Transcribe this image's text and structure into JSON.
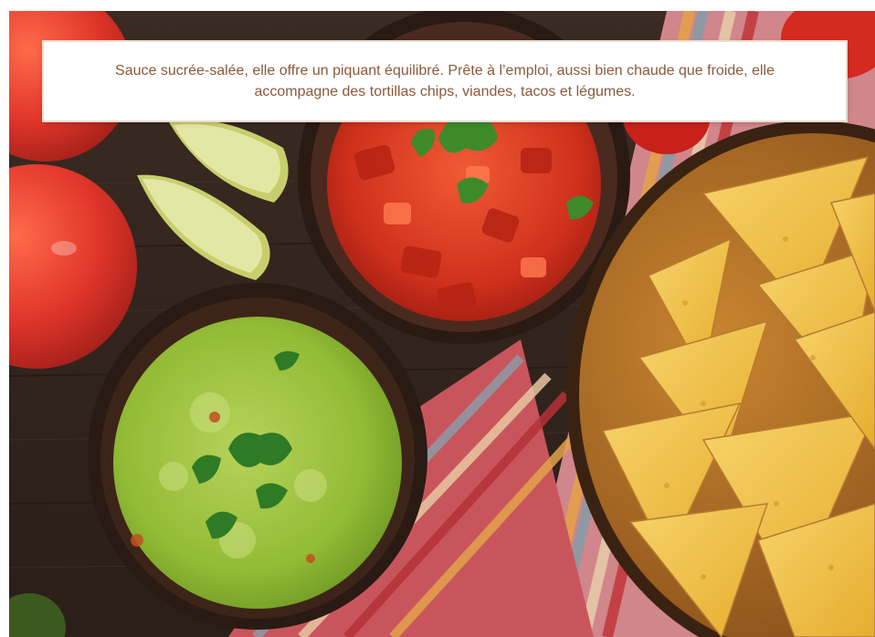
{
  "caption": {
    "text": "Sauce sucrée-salée, elle offre un piquant équilibré. Prête à l’emploi, aussi bien chaude que froide, elle accompagne des tortillas chips, viandes, tacos et légumes."
  },
  "photo": {
    "subject": "salsa-guacamole-nachos",
    "colors": {
      "caption_text": "#8a5a3c",
      "wood": "#3a2a21",
      "guacamole": "#9cc23c",
      "salsa": "#d8381f",
      "chips": "#f0c040",
      "tomato": "#e0382a",
      "lime": "#d9de8a"
    }
  }
}
